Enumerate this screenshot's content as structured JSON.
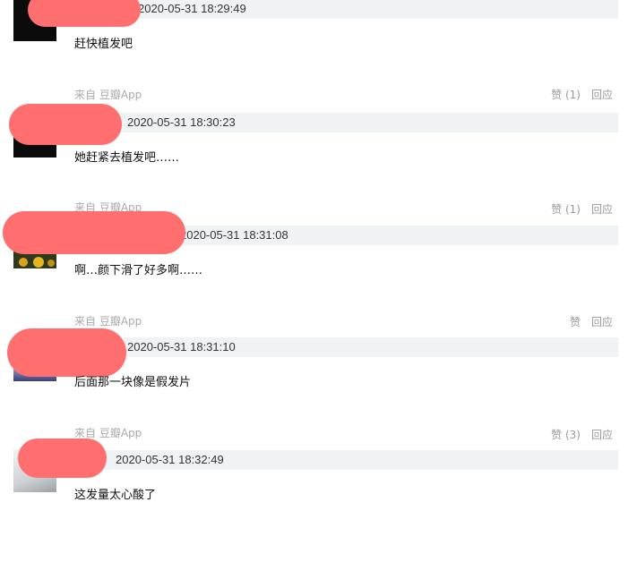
{
  "comments": [
    {
      "timestamp": "2020-05-31 18:29:49",
      "content": "赶快植发吧",
      "source": "来自 豆瓣App",
      "like_label": "赞",
      "like_count": "(1)",
      "reply_label": "回应"
    },
    {
      "timestamp": "2020-05-31 18:30:23",
      "content": "她赶紧去植发吧……",
      "source": "来自 豆瓣App",
      "like_label": "赞",
      "like_count": "(1)",
      "reply_label": "回应"
    },
    {
      "timestamp": "2020-05-31 18:31:08",
      "content": "啊…颜下滑了好多啊……",
      "source": "来自 豆瓣App",
      "like_label": "赞",
      "like_count": "",
      "reply_label": "回应"
    },
    {
      "timestamp": "2020-05-31 18:31:10",
      "content": "后面那一块像是假发片",
      "source": "来自 豆瓣App",
      "like_label": "赞",
      "like_count": "(3)",
      "reply_label": "回应"
    },
    {
      "timestamp": "2020-05-31 18:32:49",
      "content": "这发量太心酸了",
      "source": "",
      "like_label": "",
      "like_count": "",
      "reply_label": ""
    }
  ],
  "colors": {
    "redaction": "#ff6f6f",
    "meta_bar": "#f0f3f5",
    "muted_text": "#999999"
  }
}
